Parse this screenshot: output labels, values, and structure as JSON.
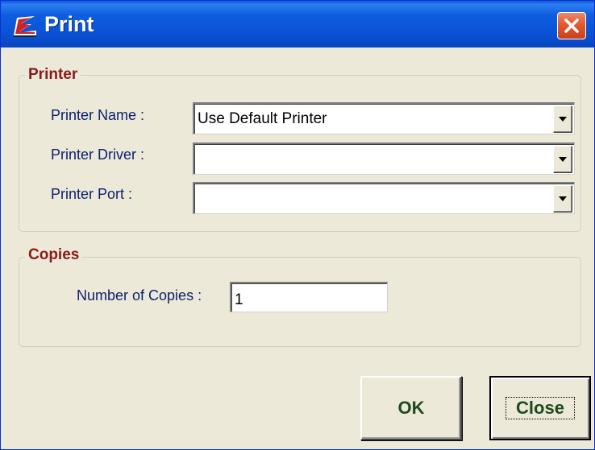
{
  "window": {
    "title": "Print",
    "app_icon": "app-logo-icon",
    "close_icon": "close-icon"
  },
  "printer_group": {
    "legend": "Printer",
    "fields": [
      {
        "label": "Printer Name :",
        "value": "Use Default Printer"
      },
      {
        "label": "Printer Driver :",
        "value": ""
      },
      {
        "label": "Printer Port :",
        "value": ""
      }
    ]
  },
  "copies_group": {
    "legend": "Copies",
    "label": "Number of Copies :",
    "value": "1"
  },
  "buttons": {
    "ok_label": "OK",
    "close_label": "Close"
  },
  "colors": {
    "titlebar": "#0a52d4",
    "legend_text": "#8b1a1a",
    "label_text": "#0a1f6e",
    "button_text": "#1e4a1e",
    "close_button": "#e05a32"
  }
}
